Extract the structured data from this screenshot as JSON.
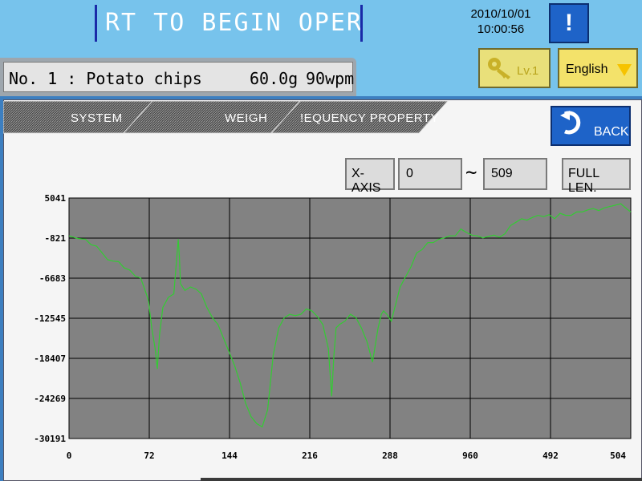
{
  "header": {
    "banner": "RT TO BEGIN OPERATI(",
    "date": "2010/10/01",
    "time": "10:00:56",
    "alert_label": "!"
  },
  "product": {
    "name": "No. 1 : Potato chips",
    "weight": "60.0g",
    "speed": "90wpm"
  },
  "level": {
    "label": "Lv.1",
    "icon": "key-icon"
  },
  "language": {
    "label": "English",
    "icon": "dropdown-triangle-icon"
  },
  "tabs": [
    {
      "label": "SYSTEM"
    },
    {
      "label": "WEIGH"
    },
    {
      "label": "!EQUENCY PROPERTY"
    }
  ],
  "back": {
    "label": "BACK",
    "icon": "back-arrow-icon"
  },
  "xaxis": {
    "label": "X-AXIS",
    "from": "0",
    "tilde": "~",
    "to": "509",
    "full_label": "FULL LEN."
  },
  "colors": {
    "line": "#33cc33",
    "plot_bg": "#828282",
    "grid": "#000000",
    "accent_blue": "#1e63c8",
    "header_bg": "#77c3ec"
  },
  "chart_data": {
    "type": "line",
    "title": "",
    "xlabel": "",
    "ylabel": "",
    "grid": true,
    "xlim": [
      0,
      509
    ],
    "ylim": [
      -30191,
      5041
    ],
    "xticks": [
      "0",
      "72",
      "144",
      "216",
      "288",
      "960",
      "492",
      "504"
    ],
    "yticks": [
      "5041",
      "-821",
      "-6683",
      "-12545",
      "-18407",
      "-24269",
      "-30191"
    ],
    "series": [
      {
        "x": [
          0,
          8,
          15,
          20,
          25,
          30,
          35,
          40,
          45,
          50,
          55,
          60,
          65,
          70,
          72,
          75,
          78,
          80,
          82,
          85,
          90,
          95,
          99,
          100,
          101,
          105,
          110,
          115,
          120,
          125,
          130,
          135,
          140,
          145,
          150,
          155,
          160,
          165,
          170,
          175,
          180,
          185,
          190,
          195,
          200,
          205,
          210,
          215,
          220,
          225,
          230,
          235,
          238,
          240,
          242,
          245,
          250,
          255,
          260,
          265,
          270,
          275,
          280,
          283,
          285,
          288,
          292,
          296,
          300,
          305,
          310,
          315,
          320,
          325,
          330,
          335,
          340,
          345,
          350,
          355,
          360,
          365,
          370,
          375,
          380,
          385,
          390,
          395,
          400,
          405,
          410,
          415,
          420,
          425,
          430,
          435,
          440,
          445,
          450,
          455,
          460,
          465,
          470,
          475,
          480,
          485,
          490,
          495,
          500,
          505,
          509
        ],
        "values": [
          -500,
          -900,
          -1000,
          -1800,
          -2000,
          -3000,
          -4000,
          -4200,
          -4300,
          -5200,
          -5500,
          -6400,
          -6700,
          -9000,
          -10000,
          -14000,
          -17000,
          -20000,
          -15000,
          -11000,
          -9500,
          -9000,
          -1000,
          -3500,
          -7500,
          -8500,
          -8000,
          -8300,
          -9000,
          -11000,
          -12500,
          -13500,
          -15500,
          -17500,
          -19500,
          -22000,
          -25000,
          -27000,
          -28000,
          -28500,
          -26000,
          -18000,
          -14000,
          -12500,
          -12000,
          -12200,
          -12000,
          -11200,
          -11500,
          -12300,
          -13500,
          -17000,
          -24000,
          -18000,
          -14000,
          -13500,
          -13000,
          -12000,
          -12500,
          -14000,
          -16000,
          -19000,
          -14000,
          -12000,
          -11500,
          -12000,
          -13000,
          -10500,
          -8000,
          -6500,
          -5000,
          -3000,
          -2500,
          -1500,
          -1500,
          -1000,
          -800,
          -500,
          -500,
          500,
          0,
          -400,
          -500,
          -800,
          -600,
          -400,
          -700,
          -200,
          1000,
          1500,
          2000,
          1800,
          2200,
          2500,
          2300,
          2600,
          2000,
          2800,
          2500,
          2500,
          3000,
          3000,
          3300,
          3500,
          3200,
          3600,
          3800,
          4000,
          4200,
          3500,
          3000
        ]
      }
    ]
  }
}
